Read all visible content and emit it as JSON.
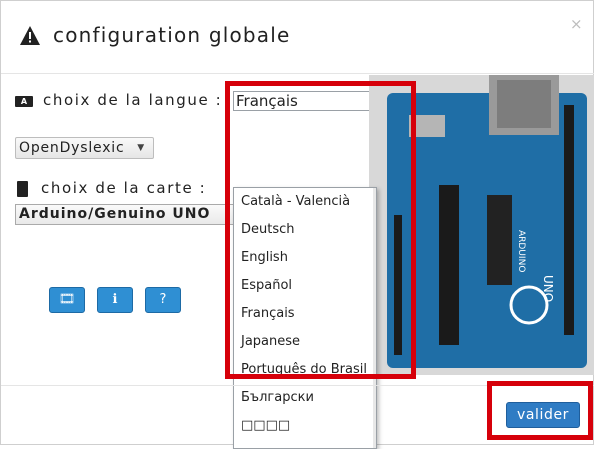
{
  "dialog": {
    "title": "configuration globale",
    "close_label": "×",
    "warn_icon": "warning-icon"
  },
  "language": {
    "label": "choix de la langue :",
    "selected": "Français",
    "options": [
      "Català - Valencià",
      "Deutsch",
      "English",
      "Español",
      "Français",
      "Japanese",
      "Português do Brasil",
      "Български",
      "□□□□"
    ]
  },
  "font": {
    "selected": "OpenDyslexic"
  },
  "board": {
    "label": "choix de la carte :",
    "selected": "Arduino/Genuino UNO"
  },
  "icon_buttons": [
    {
      "icon": "film-icon",
      "glyph": "🎞"
    },
    {
      "icon": "info-icon",
      "glyph": "ℹ"
    },
    {
      "icon": "help-icon",
      "glyph": "?"
    }
  ],
  "footer": {
    "submit_label": "valider"
  },
  "colors": {
    "accent": "#2f7cc4",
    "highlight": "#d6000a",
    "board": "#1f6ea6"
  }
}
